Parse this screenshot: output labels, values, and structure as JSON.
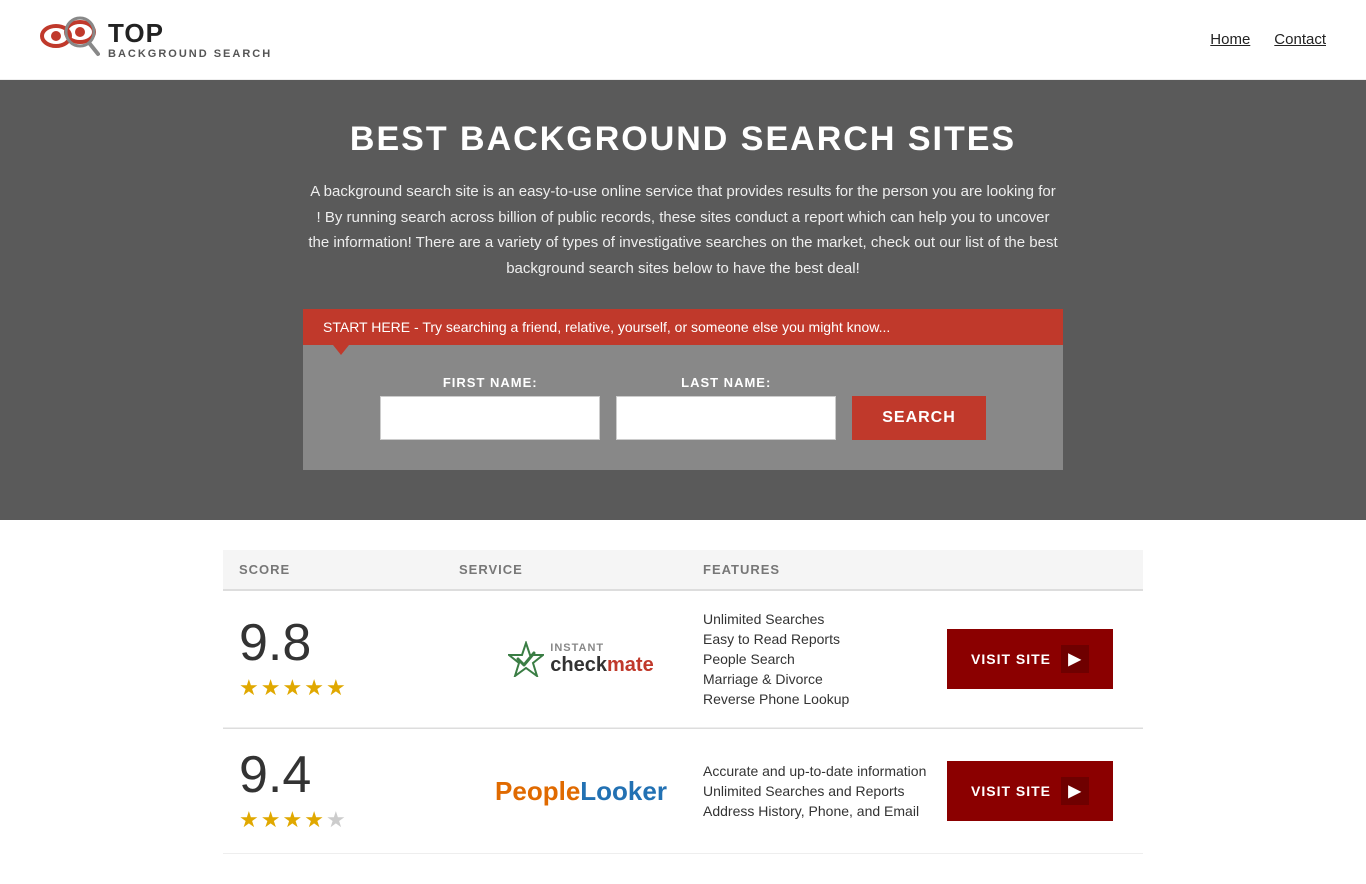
{
  "header": {
    "logo_top": "TOP",
    "logo_bottom": "BACKGROUND SEARCH",
    "nav": [
      {
        "label": "Home",
        "href": "#"
      },
      {
        "label": "Contact",
        "href": "#"
      }
    ]
  },
  "hero": {
    "title": "BEST BACKGROUND SEARCH SITES",
    "description": "A background search site is an easy-to-use online service that provides results  for the person you are looking for ! By  running  search across billion of public records, these sites conduct  a report which can help you to uncover the information! There are a variety of types of investigative searches on the market, check out our  list of the best background search sites below to have the best deal!",
    "banner_text": "START HERE - Try searching a friend, relative, yourself, or someone else you might know...",
    "first_name_label": "FIRST NAME:",
    "last_name_label": "LAST NAME:",
    "search_button": "SEARCH",
    "first_name_placeholder": "",
    "last_name_placeholder": ""
  },
  "table": {
    "columns": [
      "SCORE",
      "SERVICE",
      "FEATURES",
      ""
    ],
    "rows": [
      {
        "score": "9.8",
        "stars": 5,
        "service_name": "Instant Checkmate",
        "features": [
          "Unlimited Searches",
          "Easy to Read Reports",
          "People Search",
          "Marriage & Divorce",
          "Reverse Phone Lookup"
        ],
        "visit_label": "VISIT SITE"
      },
      {
        "score": "9.4",
        "stars": 4,
        "service_name": "PeopleLooker",
        "features": [
          "Accurate and up-to-date information",
          "Unlimited Searches and Reports",
          "Address History, Phone, and Email"
        ],
        "visit_label": "VISIT SITE"
      }
    ]
  }
}
